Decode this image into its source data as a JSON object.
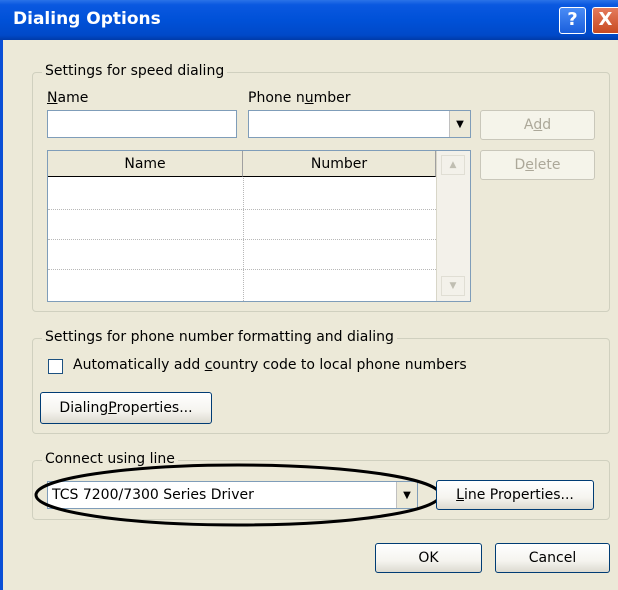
{
  "window": {
    "title": "Dialing Options"
  },
  "title_buttons": {
    "help": "?",
    "close": "X"
  },
  "speed_dialing": {
    "legend": "Settings for speed dialing",
    "name_label_first": "N",
    "name_label_rest": "ame",
    "phone_label_pre": "Phone n",
    "phone_label_u": "u",
    "phone_label_post": "mber",
    "name_value": "",
    "phone_value": "",
    "add_pre": "A",
    "add_u": "d",
    "add_post": "d",
    "delete_pre": "D",
    "delete_u": "e",
    "delete_post": "lete",
    "table_columns": [
      "Name",
      "Number"
    ]
  },
  "formatting": {
    "legend": "Settings for phone number formatting and dialing",
    "checkbox_pre": "Automatically add ",
    "checkbox_u": "c",
    "checkbox_post": "ountry code to local phone numbers",
    "checkbox_checked": false,
    "props_pre": "Dialing ",
    "props_u": "P",
    "props_post": "roperties..."
  },
  "connect": {
    "legend": "Connect using line",
    "selected_line": "TCS 7200/7300 Series Driver",
    "line_props_u": "L",
    "line_props_post": "ine Properties..."
  },
  "footer": {
    "ok": "OK",
    "cancel": "Cancel"
  },
  "icons": {
    "dropdown": "▼",
    "scroll_up": "▲",
    "scroll_down": "▼"
  }
}
